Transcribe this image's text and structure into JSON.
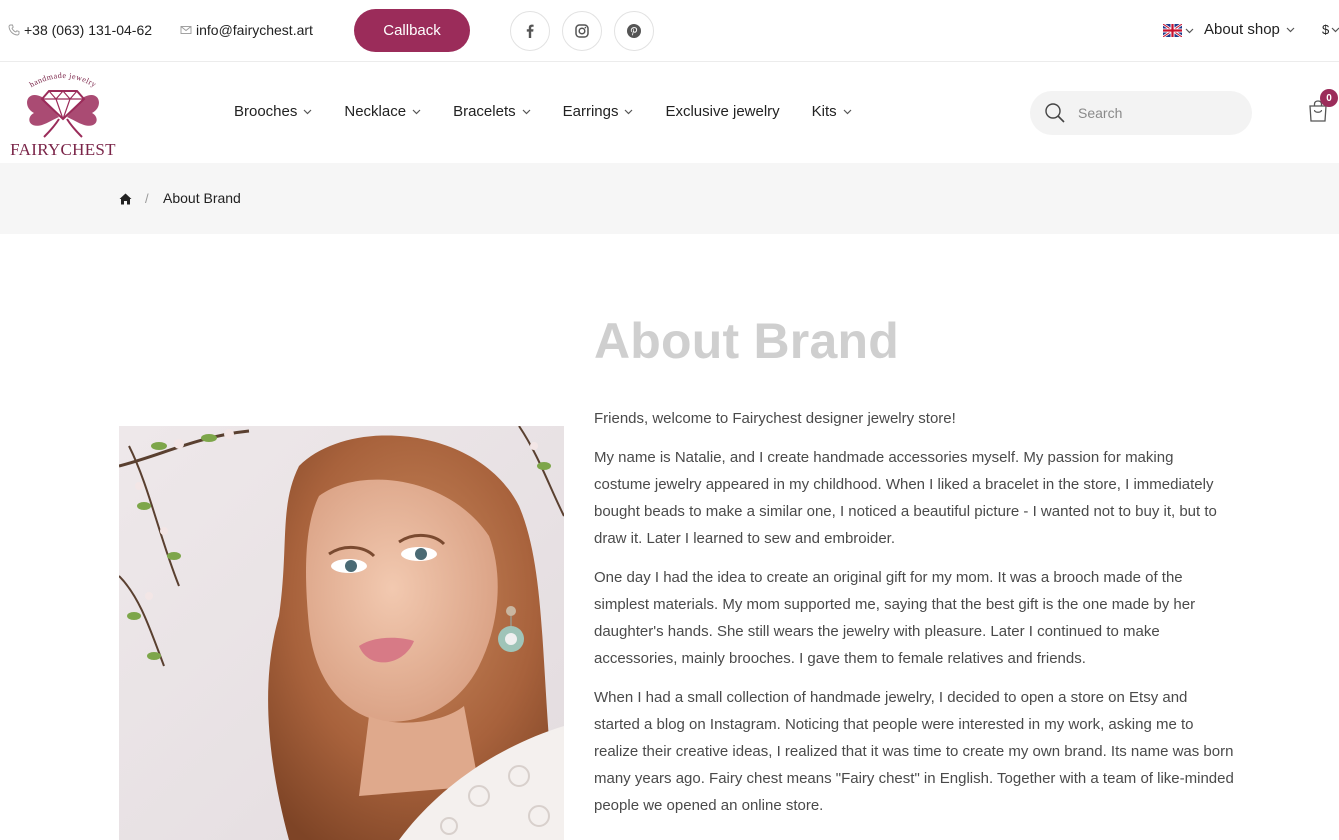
{
  "topbar": {
    "phone": "+38 (063) 131-04-62",
    "email": "info@fairychest.art",
    "callback_label": "Callback",
    "social": [
      "facebook-icon",
      "instagram-icon",
      "pinterest-icon"
    ],
    "language_flag": "uk-flag-icon",
    "about_shop_label": "About shop",
    "currency": "$"
  },
  "logo": {
    "tagline": "handmade jewelry",
    "name": "FAIRYCHEST"
  },
  "nav": {
    "items": [
      {
        "label": "Brooches",
        "dropdown": true
      },
      {
        "label": "Necklace",
        "dropdown": true
      },
      {
        "label": "Bracelets",
        "dropdown": true
      },
      {
        "label": "Earrings",
        "dropdown": true
      },
      {
        "label": "Exclusive jewelry",
        "dropdown": false
      },
      {
        "label": "Kits",
        "dropdown": true
      }
    ]
  },
  "search": {
    "placeholder": "Search",
    "value": ""
  },
  "cart": {
    "count": "0"
  },
  "breadcrumb": {
    "separator": "/",
    "current": "About Brand"
  },
  "main": {
    "title": "About Brand",
    "paragraphs": [
      "Friends, welcome to Fairychest designer jewelry store!",
      "My name is Natalie, and I create handmade accessories myself. My passion for making costume jewelry appeared in my childhood. When I liked a bracelet in the store, I immediately bought beads to make a similar one, I noticed a beautiful picture - I wanted not to buy it, but to draw it. Later I learned to sew and embroider.",
      "One day I had the idea to create an original gift for my mom. It was a brooch made of the simplest materials. My mom supported me, saying that the best gift is the one made by her daughter's hands. She still wears the jewelry with pleasure. Later I continued to make accessories, mainly brooches. I gave them to female relatives and friends.",
      "When I had a small collection of handmade jewelry, I decided to open a store on Etsy and started a blog on Instagram. Noticing that people were interested in my work, asking me to realize their creative ideas, I realized that it was time to create my own brand. Its name was born many years ago. Fairy chest means \"Fairy chest\" in English. Together with a team of like-minded people we opened an online store."
    ]
  },
  "colors": {
    "brand": "#9b2c5a",
    "title_gray": "#cfcfcf",
    "breadcrumb_bg": "#f6f6f6"
  }
}
